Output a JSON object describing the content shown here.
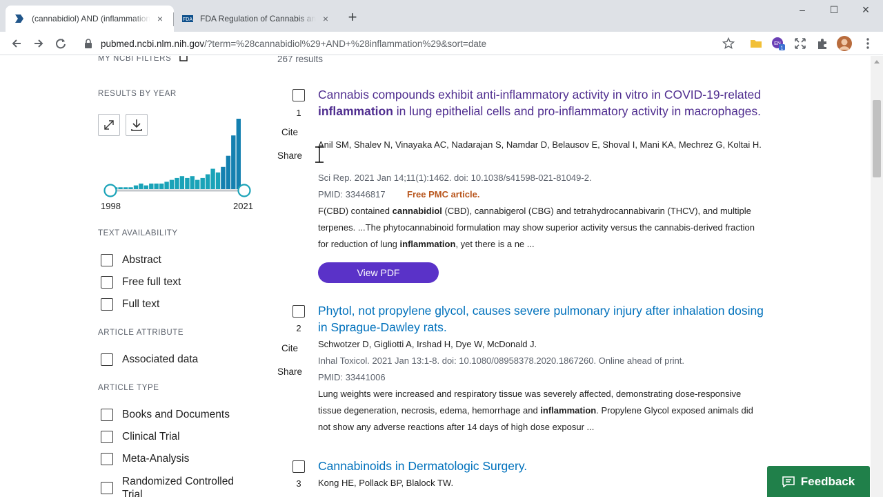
{
  "browser": {
    "tabs": [
      {
        "title": "(cannabidiol) AND (inflammation)",
        "close": "×"
      },
      {
        "title": "FDA Regulation of Cannabis and Cannabis-Derived Products",
        "close": "×"
      }
    ],
    "new_tab": "+",
    "url_host": "pubmed.ncbi.nlm.nih.gov",
    "url_rest": "/?term=%28cannabidiol%29+AND+%28inflammation%29&sort=date",
    "window_controls": {
      "minimize": "–",
      "maximize": "☐",
      "close": "×"
    },
    "profile_badge": "1"
  },
  "sidebar": {
    "my_ncbi_filters": "MY NCBI FILTERS",
    "results_by_year": "RESULTS BY YEAR",
    "year_start": "1998",
    "year_end": "2021",
    "year_bars": [
      1,
      1,
      1,
      1,
      2,
      3,
      2,
      3,
      3,
      3,
      4,
      5,
      6,
      7,
      6,
      7,
      5,
      6,
      8,
      11,
      9,
      12,
      18,
      29,
      38
    ],
    "text_availability": {
      "heading": "TEXT AVAILABILITY",
      "options": [
        "Abstract",
        "Free full text",
        "Full text"
      ]
    },
    "article_attribute": {
      "heading": "ARTICLE ATTRIBUTE",
      "options": [
        "Associated data"
      ]
    },
    "article_type": {
      "heading": "ARTICLE TYPE",
      "options": [
        "Books and Documents",
        "Clinical Trial",
        "Meta-Analysis",
        "Randomized Controlled Trial"
      ]
    }
  },
  "results": {
    "count": "267 results",
    "cite_label": "Cite",
    "share_label": "Share",
    "items": [
      {
        "num": "1",
        "title_a": "Cannabis compounds exhibit anti-inflammatory activity in vitro in COVID-19-related ",
        "title_b": "inflammation",
        "title_c": " in lung epithelial cells and pro-inflammatory activity in macrophages.",
        "authors": "Anil SM, Shalev N, Vinayaka AC, Nadarajan S, Namdar D, Belausov E, Shoval I, Mani KA, Mechrez G, Koltai H.",
        "citation": "Sci Rep. 2021 Jan 14;11(1):1462. doi: 10.1038/s41598-021-81049-2.",
        "pmid": "PMID: 33446817",
        "free_pmc": "Free PMC article.",
        "snippet_a": "F(CBD) contained ",
        "snippet_b": "cannabidiol",
        "snippet_c": " (CBD), cannabigerol (CBG) and tetrahydrocannabivarin (THCV), and multiple terpenes. ...The phytocannabinoid formulation may show superior activity versus the cannabis-derived fraction for reduction of lung ",
        "snippet_d": "inflammation",
        "snippet_e": ", yet there is a ne ...",
        "pdf_label": "View PDF"
      },
      {
        "num": "2",
        "title": "Phytol, not propylene glycol, causes severe pulmonary injury after inhalation dosing in Sprague-Dawley rats.",
        "authors": "Schwotzer D, Gigliotti A, Irshad H, Dye W, McDonald J.",
        "citation": "Inhal Toxicol. 2021 Jan 13:1-8. doi: 10.1080/08958378.2020.1867260. Online ahead of print.",
        "pmid": "PMID: 33441006",
        "snippet_a": "Lung weights were increased and respiratory tissue was severely affected, demonstrating dose-responsive tissue degeneration, necrosis, edema, hemorrhage and ",
        "snippet_b": "inflammation",
        "snippet_c": ". Propylene Glycol exposed animals did not show any adverse reactions after 14 days of high dose exposur ..."
      },
      {
        "num": "3",
        "title": "Cannabinoids in Dermatologic Surgery.",
        "authors": "Kong HE, Pollack BP, Blalock TW."
      }
    ]
  },
  "feedback_label": "Feedback",
  "colors": {
    "link": "#0071bc",
    "visited": "#4f2d8f",
    "pdf": "#5a32c8",
    "feedback": "#20804a",
    "pmc": "#b8551c",
    "bars": "#1aa3b8"
  }
}
